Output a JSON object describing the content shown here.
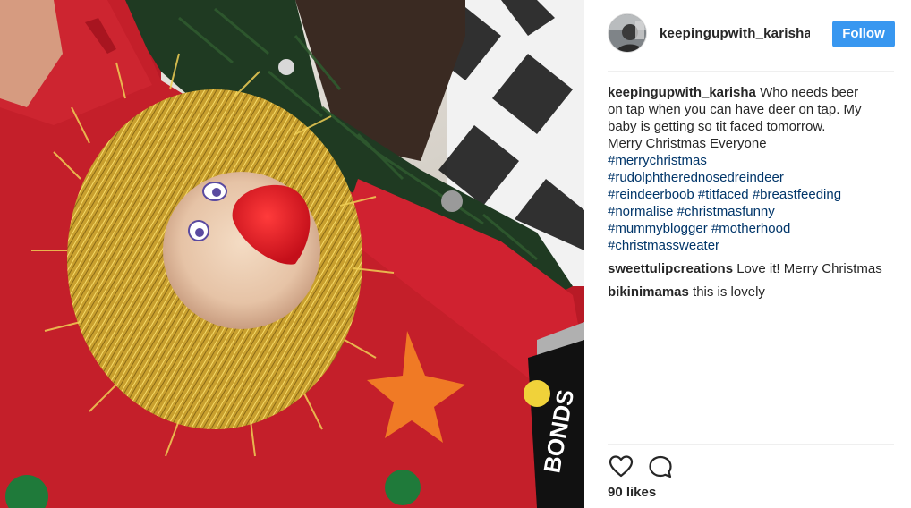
{
  "post": {
    "username": "keepingupwith_karisha",
    "follow_label": "Follow",
    "caption": {
      "username": "keepingupwith_karisha",
      "text_lines": [
        "Who needs beer",
        "on tap when you can have deer on tap. My",
        "baby is getting so tit faced tomorrow.",
        "Merry Christmas Everyone"
      ],
      "hashtag_lines": [
        [
          "#merrychristmas"
        ],
        [
          "#rudolphtherednosedreindeer"
        ],
        [
          "#reindeerboob",
          "#titfaced",
          "#breastfeeding"
        ],
        [
          "#normalise",
          "#christmasfunny"
        ],
        [
          "#mummyblogger",
          "#motherhood"
        ],
        [
          "#christmassweater"
        ]
      ]
    },
    "comments": [
      {
        "username": "sweettulipcreations",
        "text": "Love it! Merry Christmas"
      },
      {
        "username": "bikinimamas",
        "text": "this is lovely"
      }
    ],
    "likes_text": "90 likes",
    "icons": {
      "like": "heart-icon",
      "comment": "comment-bubble-icon"
    },
    "colors": {
      "follow_button": "#3897f0",
      "hashtag": "#003569",
      "sweater_red": "#c41f2a",
      "tinsel_gold": "#d9b43a"
    },
    "photo_description_visible_text": "BONDS"
  }
}
